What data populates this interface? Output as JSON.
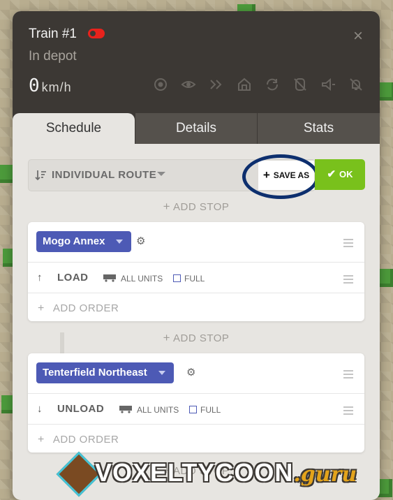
{
  "train": {
    "name": "Train #1",
    "status": "In depot",
    "speed_value": "0",
    "speed_unit": "km/h",
    "close_label": "×",
    "header_icons": [
      "go-to-icon",
      "view-icon",
      "skip-stop-icon",
      "send-to-depot-icon",
      "reverse-icon",
      "decouple-icon",
      "horn-icon",
      "notifications-off-icon"
    ]
  },
  "tabs": [
    {
      "label": "Schedule",
      "active": true
    },
    {
      "label": "Details",
      "active": false
    },
    {
      "label": "Stats",
      "active": false
    }
  ],
  "route": {
    "label": "INDIVIDUAL ROUTE",
    "save_as_label": "SAVE AS",
    "ok_label": "OK"
  },
  "add_stop_label": "ADD STOP",
  "stops": [
    {
      "station": "Mogo Annex",
      "order": {
        "arrow": "↑",
        "action": "LOAD",
        "units": "ALL UNITS",
        "condition": "FULL"
      },
      "add_order_label": "ADD ORDER"
    },
    {
      "station": "Tenterfield Northeast",
      "order": {
        "arrow": "↓",
        "action": "UNLOAD",
        "units": "ALL UNITS",
        "condition": "FULL"
      },
      "add_order_label": "ADD ORDER"
    }
  ],
  "watermark": {
    "main": "VOXELTYCOON",
    "suffix": ".guru"
  },
  "colors": {
    "header_bg": "#3c3834",
    "toggle_red": "#e8221c",
    "station_blue": "#4d5ab5",
    "ok_green": "#79c11c",
    "highlight_ring": "#0d2f6e"
  }
}
